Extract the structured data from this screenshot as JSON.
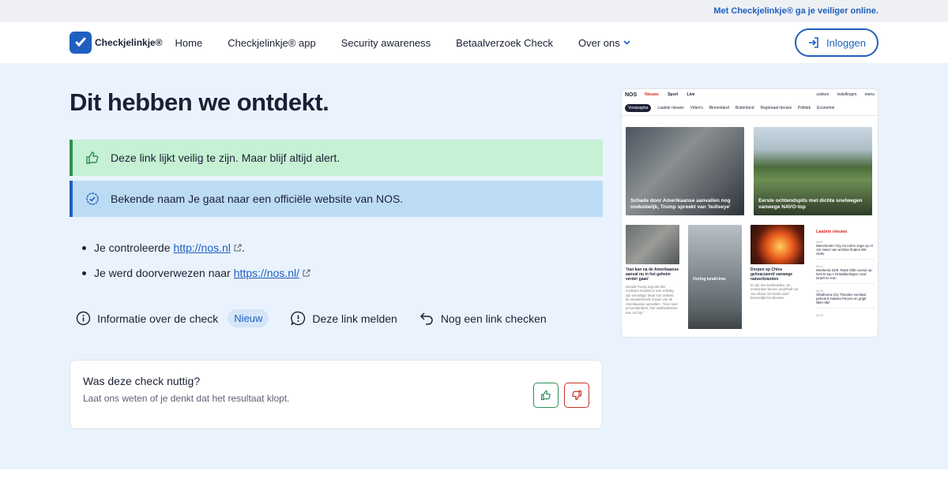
{
  "topbar": {
    "text": "Met Checkjelinkje® ga je veiliger online."
  },
  "header": {
    "logo_text": "Checkjelinkje®",
    "nav": [
      "Home",
      "Checkjelinkje® app",
      "Security awareness",
      "Betaalverzoek Check",
      "Over ons"
    ],
    "login_label": "Inloggen"
  },
  "main": {
    "title": "Dit hebben we ontdekt.",
    "alert_safe": "Deze link lijkt veilig te zijn. Maar blijf altijd alert.",
    "alert_known": "Bekende naam  Je gaat naar een officiële website van NOS.",
    "bullet1_prefix": "Je controleerde",
    "bullet1_link": "http://nos.nl",
    "bullet1_suffix": ".",
    "bullet2_prefix": "Je werd doorverwezen naar",
    "bullet2_link": "https://nos.nl/"
  },
  "actions": {
    "info": "Informatie over de check",
    "info_badge": "Nieuw",
    "report": "Deze link melden",
    "again": "Nog een link checken"
  },
  "feedback": {
    "title": "Was deze check nuttig?",
    "subtitle": "Laat ons weten of je denkt dat het resultaat klopt."
  },
  "preview": {
    "logo": "NOS",
    "tabs": [
      "Nieuws",
      "Sport",
      "Live"
    ],
    "right": [
      "zoeken",
      "instellingen",
      "menu"
    ],
    "subnav": [
      "Voorpagina",
      "Laatste nieuws",
      "Video's",
      "Binnenland",
      "Buitenland",
      "Regionaal nieuws",
      "Politiek",
      "Economie"
    ],
    "card1": "Schade door Amerikaanse aanvallen nog onduidelijk, Trump spreekt van 'bullseye'",
    "card2": "Eerste ochtendspits met dichte snelwegen vanwege NAVO-top",
    "small1_title": "'Iran kan na de Amerikaanse aanval nu in het geheim verder gaan'",
    "small1_body": "Donald Trump zegt dat drie nucleaire locaties in Iran volledig zijn vernietigd. Maar hoe ontkent de verwoestende impact van de Amerikaanse aanvallen. \"Hoe meer je bombardeert, hoe vastbeslotener Iran zal zijn.\"",
    "small2_title": "Oorlog Israël-Iran",
    "small3_title": "Dorpen op Chios geëvacueerd vanwege natuurbranden",
    "small3_body": "Er zijn drie bosbranden. De ontstonden binnen anderhalf uur van elkaar. De harde wind bemoeilijkt het blussen.",
    "latest_heading": "Laatste nieuws",
    "latest": [
      {
        "time": "06:51",
        "text": "Manchester City na ruime zege op Al Ain zeker van achtste finales WK clubs"
      },
      {
        "time": "06:47",
        "text": "Weekend 23/6: Rutte blikt vooruit op NAVO-top • Ontwikkelingen rond Israël en Iran"
      },
      {
        "time": "06:36",
        "text": "Oklahoma City Thunder verslaat geheerd Indiana Pacers en grijpt NBA-titel"
      },
      {
        "time": "06:09",
        "text": ""
      }
    ]
  }
}
